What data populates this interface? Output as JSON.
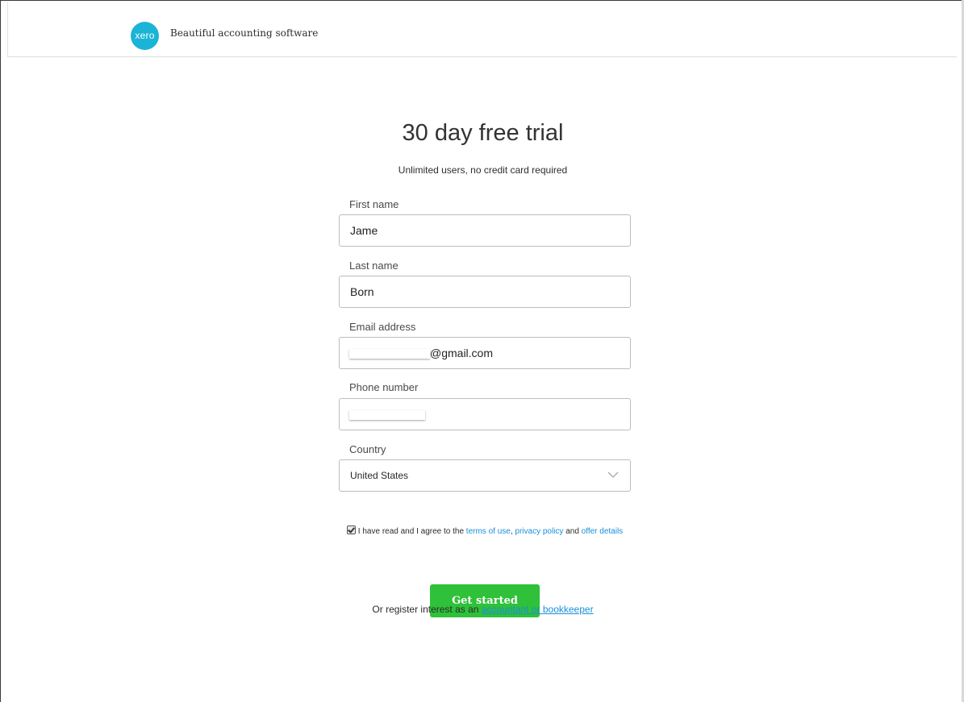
{
  "header": {
    "logo_text": "xero",
    "tagline": "Beautiful accounting software",
    "brand_color": "#1ab4d7"
  },
  "hero": {
    "title": "30 day free trial",
    "subtitle": "Unlimited users, no credit card required"
  },
  "form": {
    "first_name": {
      "label": "First name",
      "value": "Jame"
    },
    "last_name": {
      "label": "Last name",
      "value": "Born"
    },
    "email": {
      "label": "Email address",
      "value_visible": "@gmail.com"
    },
    "phone": {
      "label": "Phone number"
    },
    "country": {
      "label": "Country",
      "value": "United States",
      "icon": "chevron-down-icon"
    }
  },
  "agreement": {
    "checked": true,
    "prefix": "I have read and I agree to the",
    "terms_link": "terms of use",
    "sep1": ",",
    "privacy_link": "privacy policy",
    "and": "and",
    "offer_link": "offer details"
  },
  "cta": {
    "label": "Get started",
    "color": "#2ec139"
  },
  "footer": {
    "prefix": "Or register interest as an",
    "link": "accountant or bookkeeper"
  },
  "colors": {
    "link": "#1a8fd8"
  }
}
